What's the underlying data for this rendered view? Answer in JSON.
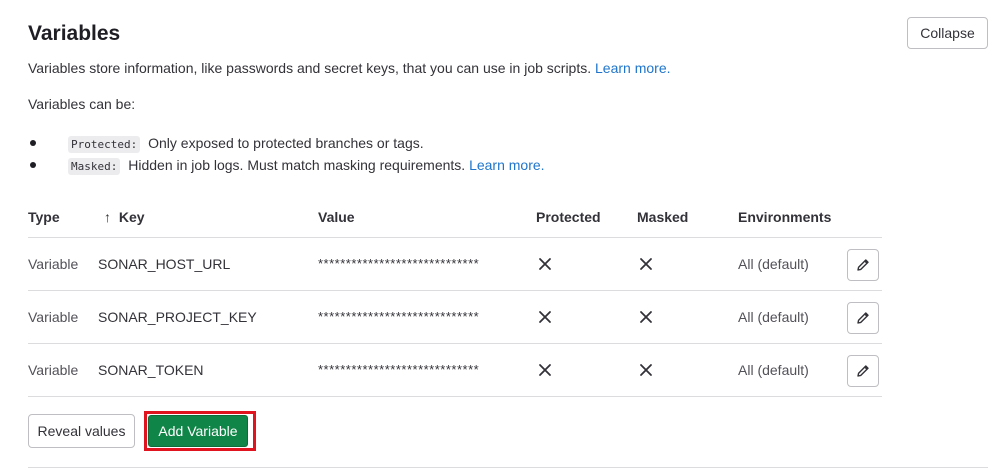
{
  "header": {
    "title": "Variables",
    "collapse_label": "Collapse"
  },
  "description": {
    "text": "Variables store information, like passwords and secret keys, that you can use in job scripts.",
    "link": "Learn more."
  },
  "can_be": "Variables can be:",
  "rules": [
    {
      "code": "Protected:",
      "text": "Only exposed to protected branches or tags.",
      "link": ""
    },
    {
      "code": "Masked:",
      "text": "Hidden in job logs. Must match masking requirements.",
      "link": "Learn more."
    }
  ],
  "table": {
    "columns": {
      "type": "Type",
      "key": "Key",
      "value": "Value",
      "protected": "Protected",
      "masked": "Masked",
      "environments": "Environments"
    },
    "sort_icon": "arrow-up-icon",
    "rows": [
      {
        "type": "Variable",
        "key": "SONAR_HOST_URL",
        "value": "*****************************",
        "protected": "false",
        "masked": "false",
        "environment": "All (default)"
      },
      {
        "type": "Variable",
        "key": "SONAR_PROJECT_KEY",
        "value": "*****************************",
        "protected": "false",
        "masked": "false",
        "environment": "All (default)"
      },
      {
        "type": "Variable",
        "key": "SONAR_TOKEN",
        "value": "*****************************",
        "protected": "false",
        "masked": "false",
        "environment": "All (default)"
      }
    ]
  },
  "actions": {
    "reveal_label": "Reveal values",
    "add_label": "Add Variable"
  },
  "colors": {
    "primary_green": "#108548",
    "link_blue": "#1f75cb",
    "highlight_red": "#e0141e"
  }
}
